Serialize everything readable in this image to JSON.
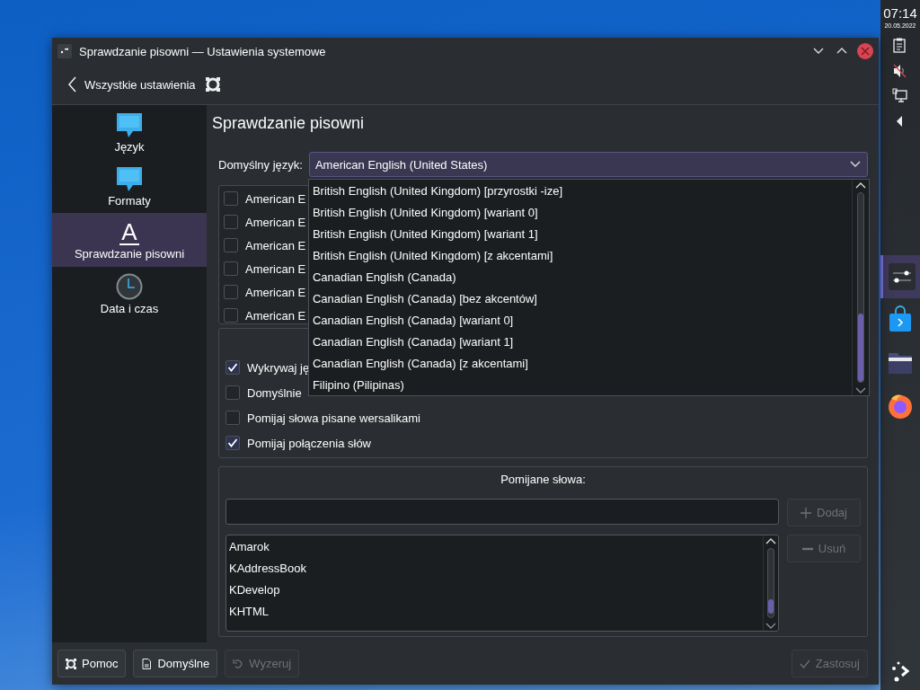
{
  "window": {
    "title": "Sprawdzanie pisowni — Ustawienia systemowe"
  },
  "toolbar": {
    "back_label": "Wszystkie ustawienia"
  },
  "sidebar": {
    "items": [
      {
        "label": "Język",
        "kind": "chat",
        "selected": false
      },
      {
        "label": "Formaty",
        "kind": "chat",
        "selected": false
      },
      {
        "label": "Sprawdzanie pisowni",
        "kind": "letter",
        "glyph": "A",
        "selected": true
      },
      {
        "label": "Data i czas",
        "kind": "clock",
        "selected": false
      }
    ]
  },
  "page": {
    "heading": "Sprawdzanie pisowni",
    "default_language": {
      "label": "Domyślny język:",
      "value": "American English (United States)",
      "expanded": true
    },
    "dictionaries": [
      {
        "label": "American E",
        "checked": false
      },
      {
        "label": "American E",
        "checked": false
      },
      {
        "label": "American E",
        "checked": false
      },
      {
        "label": "American E",
        "checked": false
      },
      {
        "label": "American E",
        "checked": false
      },
      {
        "label": "American E",
        "checked": false
      }
    ],
    "options": [
      {
        "label": "Wykrywaj ję",
        "checked": true
      },
      {
        "label": "Domyślnie",
        "checked": false
      },
      {
        "label": "Pomijaj słowa pisane wersalikami",
        "checked": false
      },
      {
        "label": "Pomijaj połączenia słów",
        "checked": true
      }
    ],
    "ignored_words": {
      "title": "Pomijane słowa:",
      "add_button": {
        "label": "Dodaj",
        "disabled": true
      },
      "remove_button": {
        "label": "Usuń",
        "disabled": true
      },
      "words": [
        "Amarok",
        "KAddressBook",
        "KDevelop",
        "KHTML"
      ]
    }
  },
  "language_menu": {
    "items": [
      "British English (United Kingdom) [przyrostki -ize]",
      "British English (United Kingdom) [wariant 0]",
      "British English (United Kingdom) [wariant 1]",
      "British English (United Kingdom) [z akcentami]",
      "Canadian English (Canada)",
      "Canadian English (Canada) [bez akcentów]",
      "Canadian English (Canada) [wariant 0]",
      "Canadian English (Canada) [wariant 1]",
      "Canadian English (Canada) [z akcentami]",
      "Filipino (Pilipinas)"
    ]
  },
  "buttons": [
    {
      "label": "Pomoc",
      "kind": "help",
      "disabled": false
    },
    {
      "label": "Domyślne",
      "kind": "defaults",
      "disabled": false
    },
    {
      "label": "Wyzeruj",
      "kind": "reset",
      "disabled": true
    },
    {
      "label": "Zastosuj",
      "kind": "apply",
      "disabled": true
    }
  ],
  "panel": {
    "time": "07:14",
    "date": "20.05.2022",
    "tray": [
      {
        "kind": "clipboard"
      },
      {
        "kind": "muted"
      },
      {
        "kind": "network"
      },
      {
        "kind": "expand"
      }
    ],
    "tasks": [
      {
        "kind": "settings",
        "selected": true
      },
      {
        "kind": "store",
        "selected": false
      },
      {
        "kind": "folder",
        "selected": false
      },
      {
        "kind": "browser",
        "selected": false
      }
    ]
  }
}
